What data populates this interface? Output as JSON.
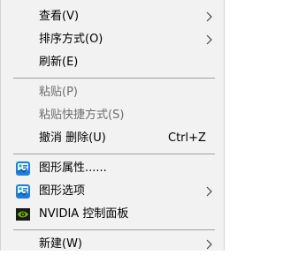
{
  "menu": {
    "view": "查看(V)",
    "sort": "排序方式(O)",
    "refresh": "刷新(E)",
    "paste": "粘贴(P)",
    "paste_shortcut": "粘贴快捷方式(S)",
    "undo": "撤消 删除(U)",
    "undo_shortcut": "Ctrl+Z",
    "graphics_properties": "图形属性......",
    "graphics_options": "图形选项",
    "nvidia": "NVIDIA 控制面板",
    "new": "新建(W)"
  },
  "icons": {
    "view_arrow": "chevron-right-icon",
    "sort_arrow": "chevron-right-icon",
    "graphics_properties": "intel-graphics-icon",
    "graphics_options": "intel-graphics-icon",
    "graphics_options_arrow": "chevron-right-icon",
    "nvidia": "nvidia-logo-icon",
    "new_arrow": "chevron-right-icon"
  },
  "colors": {
    "menu_background": "#f2f2f2",
    "disabled_text": "#6d6d6d",
    "separator": "#a0a0a0",
    "nvidia_green": "#76b900",
    "intel_blue": "#1e7fd6"
  }
}
